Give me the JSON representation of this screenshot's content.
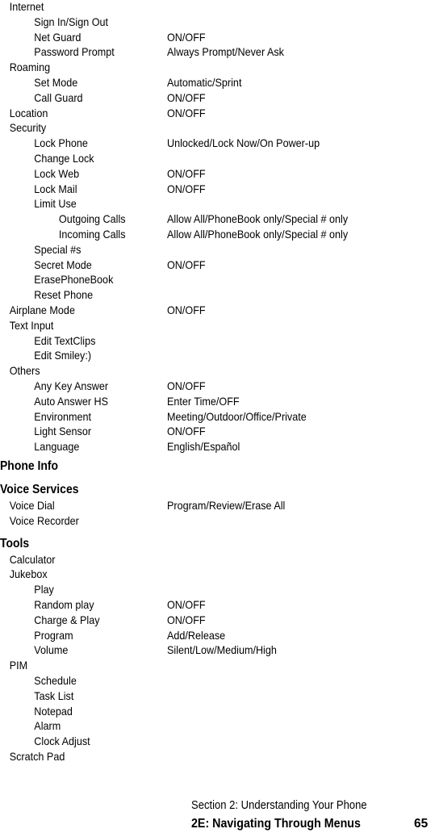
{
  "settings_items": [
    {
      "label": "Internet",
      "value": "",
      "level": 0
    },
    {
      "label": "Sign In/Sign Out",
      "value": "",
      "level": 1
    },
    {
      "label": "Net Guard",
      "value": "ON/OFF",
      "level": 1
    },
    {
      "label": "Password Prompt",
      "value": "Always Prompt/Never Ask",
      "level": 1
    },
    {
      "label": "Roaming",
      "value": "",
      "level": 0
    },
    {
      "label": "Set Mode",
      "value": "Automatic/Sprint",
      "level": 1
    },
    {
      "label": "Call Guard",
      "value": "ON/OFF",
      "level": 1
    },
    {
      "label": "Location",
      "value": "ON/OFF",
      "level": 0
    },
    {
      "label": "Security",
      "value": "",
      "level": 0
    },
    {
      "label": "Lock Phone",
      "value": "Unlocked/Lock Now/On Power-up",
      "level": 1
    },
    {
      "label": "Change Lock",
      "value": "",
      "level": 1
    },
    {
      "label": "Lock Web",
      "value": "ON/OFF",
      "level": 1
    },
    {
      "label": "Lock Mail",
      "value": "ON/OFF",
      "level": 1
    },
    {
      "label": "Limit Use",
      "value": "",
      "level": 1
    },
    {
      "label": "Outgoing Calls",
      "value": "Allow All/PhoneBook only/Special # only",
      "level": 2
    },
    {
      "label": "Incoming Calls",
      "value": "Allow All/PhoneBook only/Special # only",
      "level": 2
    },
    {
      "label": "Special #s",
      "value": "",
      "level": 1
    },
    {
      "label": "Secret Mode",
      "value": "ON/OFF",
      "level": 1
    },
    {
      "label": "ErasePhoneBook",
      "value": "",
      "level": 1
    },
    {
      "label": "Reset Phone",
      "value": "",
      "level": 1
    },
    {
      "label": "Airplane Mode",
      "value": "ON/OFF",
      "level": 0
    },
    {
      "label": "Text Input",
      "value": "",
      "level": 0
    },
    {
      "label": "Edit TextClips",
      "value": "",
      "level": 1
    },
    {
      "label": "Edit Smiley:)",
      "value": "",
      "level": 1
    },
    {
      "label": "Others",
      "value": "",
      "level": 0
    },
    {
      "label": "Any Key Answer",
      "value": "ON/OFF",
      "level": 1
    },
    {
      "label": "Auto Answer HS",
      "value": "Enter Time/OFF",
      "level": 1
    },
    {
      "label": "Environment",
      "value": "Meeting/Outdoor/Office/Private",
      "level": 1
    },
    {
      "label": "Light Sensor",
      "value": "ON/OFF",
      "level": 1
    },
    {
      "label": "Language",
      "value": "English/Español",
      "level": 1
    }
  ],
  "phone_info": {
    "heading": "Phone Info"
  },
  "voice_services": {
    "heading": "Voice Services",
    "items": [
      {
        "label": "Voice Dial",
        "value": "Program/Review/Erase All",
        "level": 0
      },
      {
        "label": "Voice Recorder",
        "value": "",
        "level": 0
      }
    ]
  },
  "tools": {
    "heading": "Tools",
    "items": [
      {
        "label": "Calculator",
        "value": "",
        "level": 0
      },
      {
        "label": "Jukebox",
        "value": "",
        "level": 0
      },
      {
        "label": "Play",
        "value": "",
        "level": 1
      },
      {
        "label": "Random play",
        "value": "ON/OFF",
        "level": 1
      },
      {
        "label": "Charge & Play",
        "value": "ON/OFF",
        "level": 1
      },
      {
        "label": "Program",
        "value": "Add/Release",
        "level": 1
      },
      {
        "label": "Volume",
        "value": "Silent/Low/Medium/High",
        "level": 1
      },
      {
        "label": "PIM",
        "value": "",
        "level": 0
      },
      {
        "label": "Schedule",
        "value": "",
        "level": 1
      },
      {
        "label": "Task List",
        "value": "",
        "level": 1
      },
      {
        "label": "Notepad",
        "value": "",
        "level": 1
      },
      {
        "label": "Alarm",
        "value": "",
        "level": 1
      },
      {
        "label": "Clock Adjust",
        "value": "",
        "level": 1
      },
      {
        "label": "Scratch Pad",
        "value": "",
        "level": 0
      }
    ]
  },
  "footer": {
    "section": "Section 2: Understanding Your Phone",
    "chapter": "2E: Navigating Through Menus",
    "page_number": "65"
  }
}
